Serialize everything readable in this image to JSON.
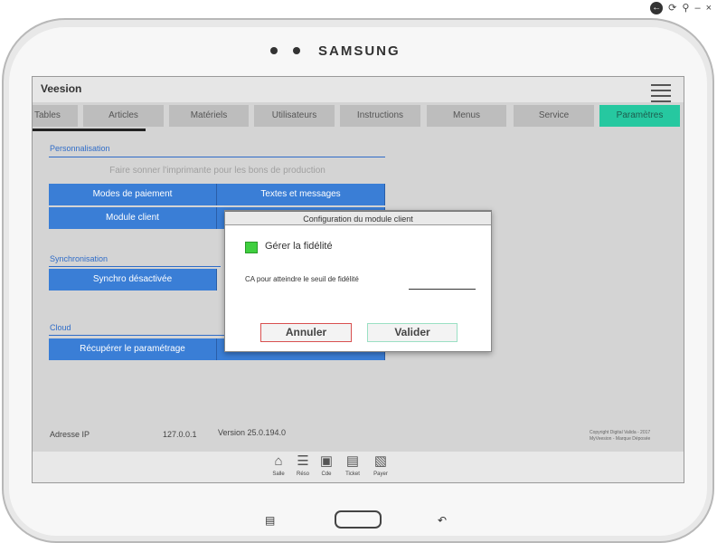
{
  "device": {
    "brand": "SAMSUNG"
  },
  "app": {
    "title": "Veesion"
  },
  "tabs": [
    {
      "label": "Tables"
    },
    {
      "label": "Articles"
    },
    {
      "label": "Matériels"
    },
    {
      "label": "Utilisateurs"
    },
    {
      "label": "Instructions"
    },
    {
      "label": "Menus"
    },
    {
      "label": "Service"
    },
    {
      "label": "Paramètres"
    }
  ],
  "sections": {
    "perso": {
      "title": "Personnalisation",
      "hint": "Faire sonner l'imprimante pour les bons de production",
      "btn_payment": "Modes de paiement",
      "btn_texts": "Textes et messages",
      "btn_client": "Module client"
    },
    "sync": {
      "title": "Synchronisation",
      "btn_sync": "Synchro désactivée"
    },
    "cloud": {
      "title": "Cloud",
      "btn_fetch": "Récupérer le paramétrage"
    }
  },
  "footer": {
    "ip_label": "Adresse IP",
    "ip_value": "127.0.0.1",
    "version": "Version 25.0.194.0",
    "copyright_1": "Copyright Digital Valida - 2017",
    "copyright_2": "MyVeesion - Marque Déposée"
  },
  "bottom_nav": [
    {
      "label": "Salle",
      "icon": "home-icon"
    },
    {
      "label": "Réso",
      "icon": "reservation-icon"
    },
    {
      "label": "Cde",
      "icon": "cart-icon"
    },
    {
      "label": "Ticket",
      "icon": "ticket-icon"
    },
    {
      "label": "Payer",
      "icon": "payment-icon"
    }
  ],
  "dialog": {
    "title": "Configuration du module client",
    "checkbox_label": "Gérer la fidélité",
    "field_label": "CA pour atteindre le seuil de fidélité",
    "field_value": "",
    "cancel": "Annuler",
    "validate": "Valider"
  },
  "colors": {
    "accent_blue": "#3a7ed6",
    "active_tab": "#26c8a0",
    "checkbox_green": "#3fcf3f",
    "cancel_border": "#d95050"
  }
}
